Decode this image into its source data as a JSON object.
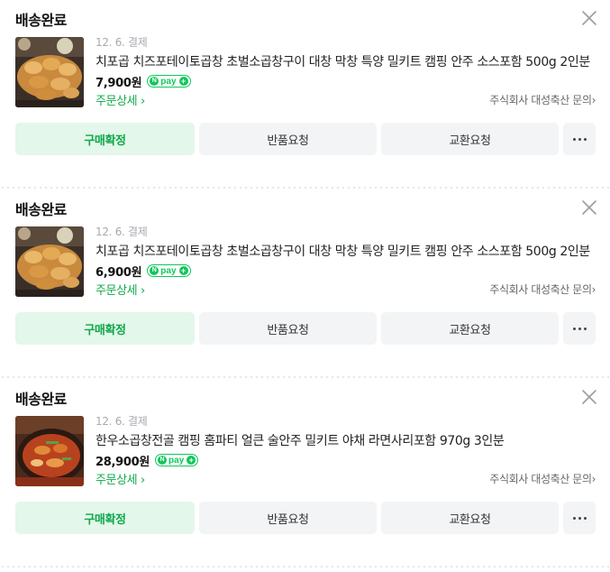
{
  "orders": [
    {
      "status": "배송완료",
      "date": "12. 6. 결제",
      "title": "치포곱 치즈포테이토곱창 초벌소곱창구이 대창 막창 특양 밀키트 캠핑 안주 소스포함 500g 2인분",
      "price": "7,900원",
      "npay_label": "pay",
      "detail_link": "주문상세",
      "seller_link": "주식회사 대성축산 문의",
      "image": "gopchang-product-thumbnail",
      "buttons": {
        "confirm": "구매확정",
        "return": "반품요청",
        "exchange": "교환요청"
      }
    },
    {
      "status": "배송완료",
      "date": "12. 6. 결제",
      "title": "치포곱 치즈포테이토곱창 초벌소곱창구이 대창 막창 특양 밀키트 캠핑 안주 소스포함 500g 2인분",
      "price": "6,900원",
      "npay_label": "pay",
      "detail_link": "주문상세",
      "seller_link": "주식회사 대성축산 문의",
      "image": "gopchang-product-thumbnail",
      "buttons": {
        "confirm": "구매확정",
        "return": "반품요청",
        "exchange": "교환요청"
      }
    },
    {
      "status": "배송완료",
      "date": "12. 6. 결제",
      "title": "한우소곱창전골 캠핑 홈파티 얼큰 술안주 밀키트 야채 라면사리포함 970g 3인분",
      "price": "28,900원",
      "npay_label": "pay",
      "detail_link": "주문상세",
      "seller_link": "주식회사 대성축산 문의",
      "image": "jeongol-stew-thumbnail",
      "buttons": {
        "confirm": "구매확정",
        "return": "반품요청",
        "exchange": "교환요청"
      }
    }
  ],
  "colors": {
    "accent": "#0fa84a",
    "npay": "#0fc85a",
    "confirm_bg": "#e3f7ea",
    "button_bg": "#f3f4f6"
  },
  "icons": {
    "close": "close-icon",
    "chevron": "chevron-right-icon",
    "more": "more-dots-icon"
  }
}
